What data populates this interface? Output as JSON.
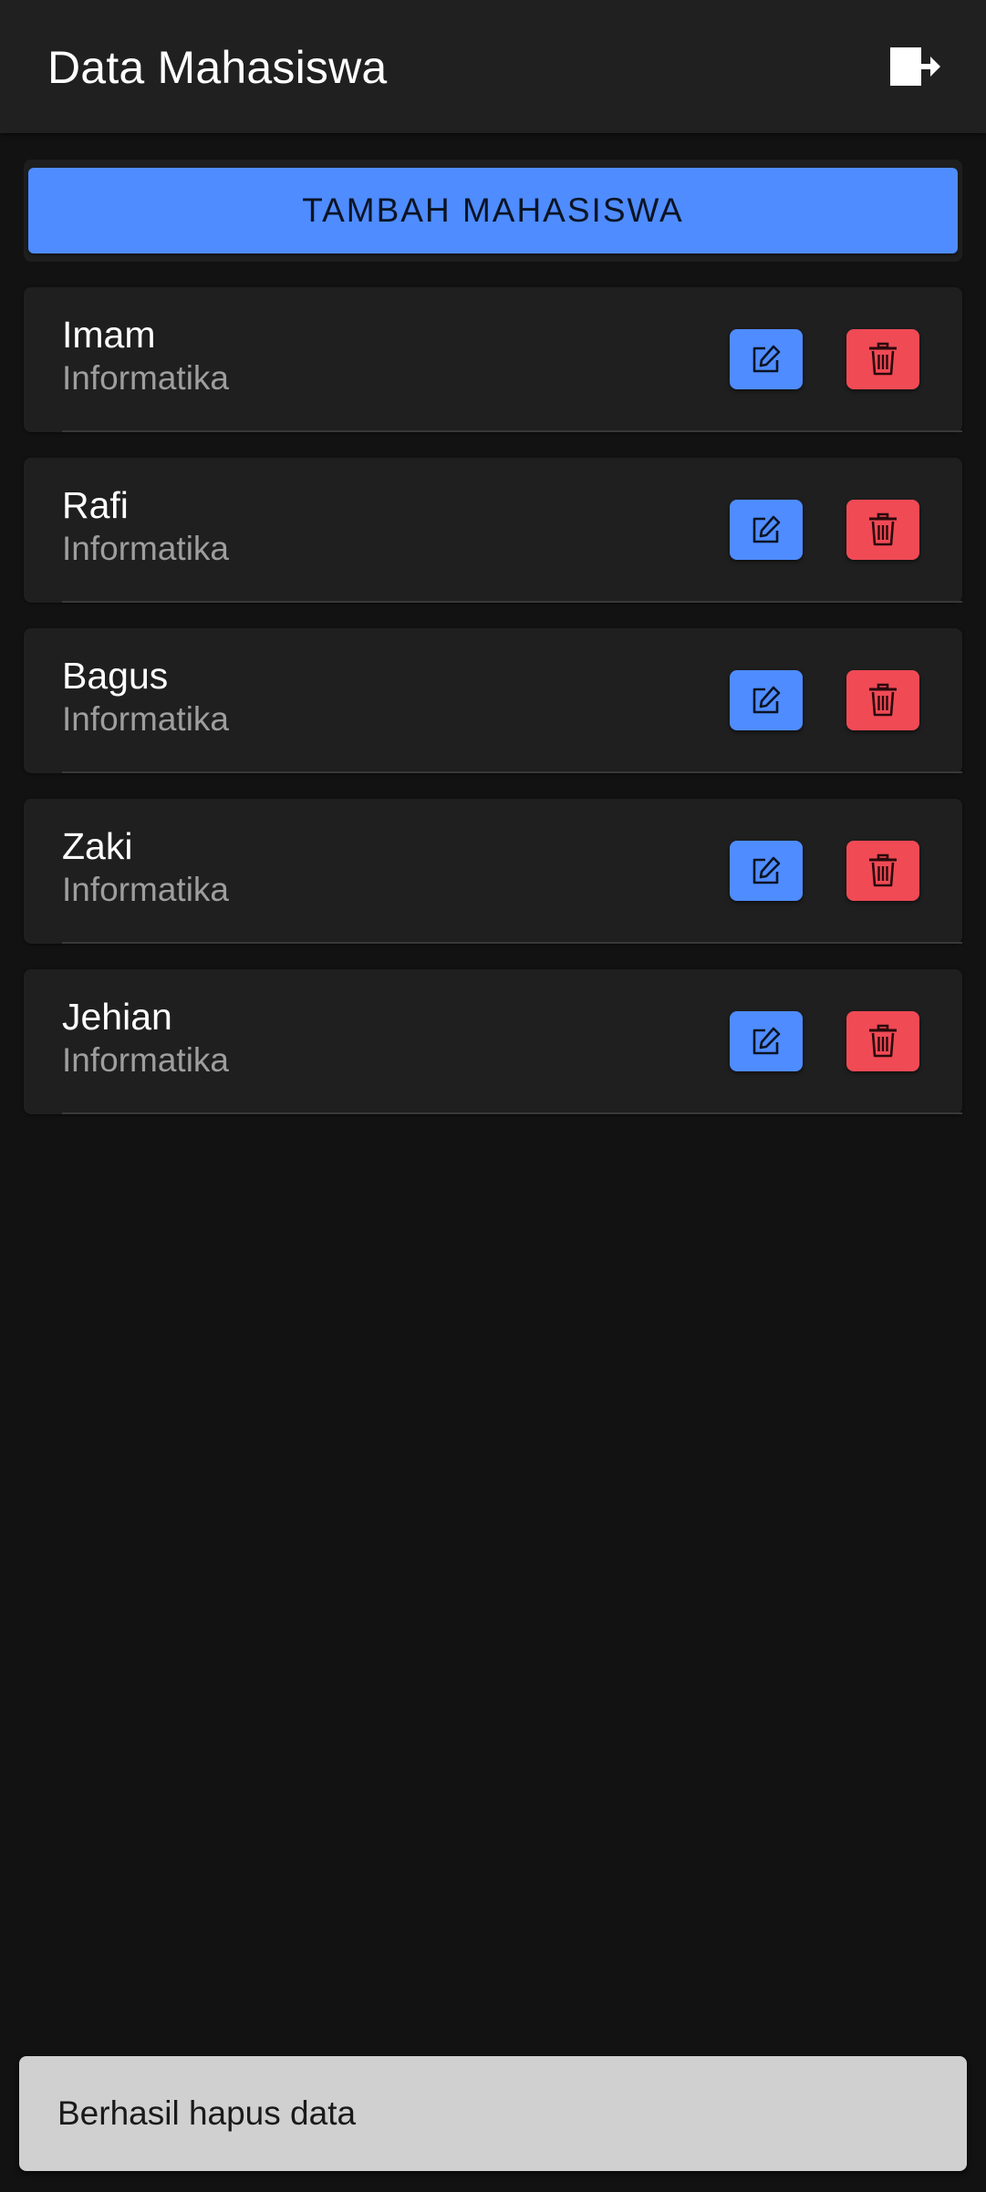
{
  "app_bar": {
    "title": "Data Mahasiswa",
    "logout_icon": "logout-icon"
  },
  "add_button": {
    "label": "TAMBAH MAHASISWA"
  },
  "colors": {
    "primary": "#4f8cff",
    "danger": "#f04a55",
    "background": "#121212",
    "surface": "#1f1f1f"
  },
  "students": [
    {
      "name": "Imam",
      "major": "Informatika"
    },
    {
      "name": "Rafi",
      "major": "Informatika"
    },
    {
      "name": "Bagus",
      "major": "Informatika"
    },
    {
      "name": "Zaki",
      "major": "Informatika"
    },
    {
      "name": "Jehian",
      "major": "Informatika"
    }
  ],
  "row_actions": {
    "edit_icon": "edit-icon",
    "delete_icon": "trash-icon"
  },
  "snackbar": {
    "message": "Berhasil hapus data"
  }
}
